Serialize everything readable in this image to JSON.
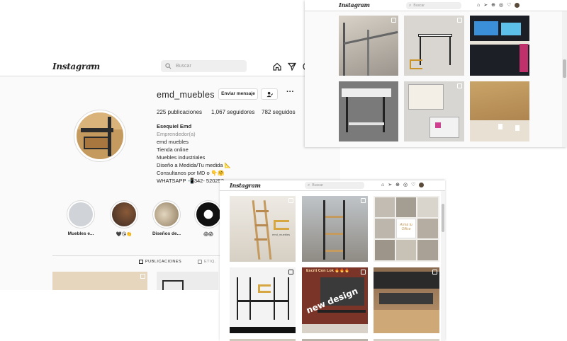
{
  "window1": {
    "header": {
      "logo": "Instagram",
      "search_placeholder": "Buscar"
    },
    "profile": {
      "username": "emd_muebles",
      "message_button": "Enviar mensaje",
      "more": "···",
      "stats": {
        "posts": "225 publicaciones",
        "followers": "1,067 seguidores",
        "following": "782 seguidos"
      },
      "bio": {
        "name": "Esequiel Emd",
        "category": "Emprendedor(a)",
        "lines": [
          "emd muebles",
          "Tienda online",
          "Muebles industriales",
          "Diseño a Medida/Tu medida 📐",
          "Consultanos por MD o 👇🤗",
          "WHATSAPP 📲342- 520252"
        ]
      }
    },
    "highlights": [
      {
        "label": "Muebles e..."
      },
      {
        "label": "🖤😘👏"
      },
      {
        "label": "Diseños de..."
      },
      {
        "label": "😱😱"
      }
    ],
    "tabs": {
      "posts": "PUBLICACIONES",
      "tagged": "ETIQ."
    }
  },
  "window2": {
    "header": {
      "logo": "Instagram",
      "search_placeholder": "Buscar"
    }
  },
  "window3": {
    "header": {
      "logo": "Instagram",
      "search_placeholder": "Buscar"
    },
    "post_text": {
      "brand": "emd_muebles",
      "collage_text": "Armá tu Office",
      "post5_top": "Escrit Con Lok 🔥🔥🔥",
      "post5_overlay": "new design"
    }
  },
  "colors": {
    "background": "#fafafa",
    "text": "#262626",
    "muted": "#8e8e8e",
    "wood": "#c49a5e",
    "metal": "#2b2b2b",
    "gold": "#d6a640"
  }
}
